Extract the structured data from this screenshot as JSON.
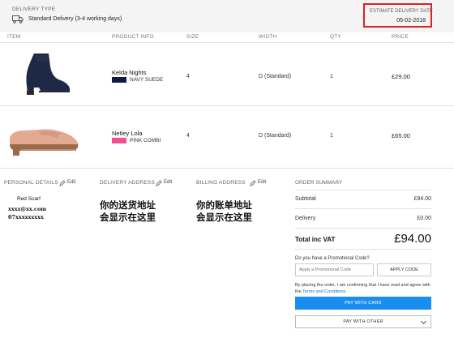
{
  "delivery": {
    "type_label": "DELIVERY TYPE",
    "type_value": "Standard Delivery (3-4 working days)",
    "estimate_label": "ESTIMATE DELIVERY DATE",
    "estimate_value": "05-02-2018"
  },
  "table": {
    "headers": [
      "ITEM",
      "PRODUCT INFO",
      "SIZE",
      "WIDTH",
      "QTY",
      "PRICE"
    ],
    "rows": [
      {
        "name": "Kelda Nights",
        "color_name": "NAVY SUEDE",
        "color_hex": "#0f1a3f",
        "size": "4",
        "width": "D (Standard)",
        "qty": "1",
        "price": "£29.00"
      },
      {
        "name": "Netley Lola",
        "color_name": "PINK COMBI",
        "color_hex": "#ef4f8c",
        "size": "4",
        "width": "D (Standard)",
        "qty": "1",
        "price": "£65.00"
      }
    ]
  },
  "details": {
    "personal_title": "PERSONAL DETAILS",
    "delivery_title": "DELIVERY ADDRESS",
    "billing_title": "BILLING ADDRESS",
    "edit_label": "Edit",
    "name": "Red Scarf",
    "email": "xxxx@xx.com",
    "phone": "07xxxxxxxxx",
    "delivery_note_1": "你的送货地址",
    "delivery_note_2": "会显示在这里",
    "billing_note_1": "你的账单地址",
    "billing_note_2": "会显示在这里"
  },
  "summary": {
    "title": "ORDER SUMMARY",
    "subtotal_label": "Subtotal",
    "subtotal_value": "£94.00",
    "delivery_label": "Delivery",
    "delivery_value": "£0.00",
    "total_label": "Total inc VAT",
    "total_value": "£94.00",
    "promo_question": "Do you have a Promotional Code?",
    "promo_placeholder": "Apply a Promotional Code",
    "apply_label": "APPLY CODE",
    "terms_text": "By placing the order, I am confirming that I have read and agree with the",
    "terms_link": "Terms and Conditions.",
    "pay_card_label": "PAY WITH CARD",
    "pay_other_label": "PAY WITH OTHER"
  },
  "colors": {
    "accent": "#1a8ef0",
    "highlight_border": "#e02020"
  }
}
